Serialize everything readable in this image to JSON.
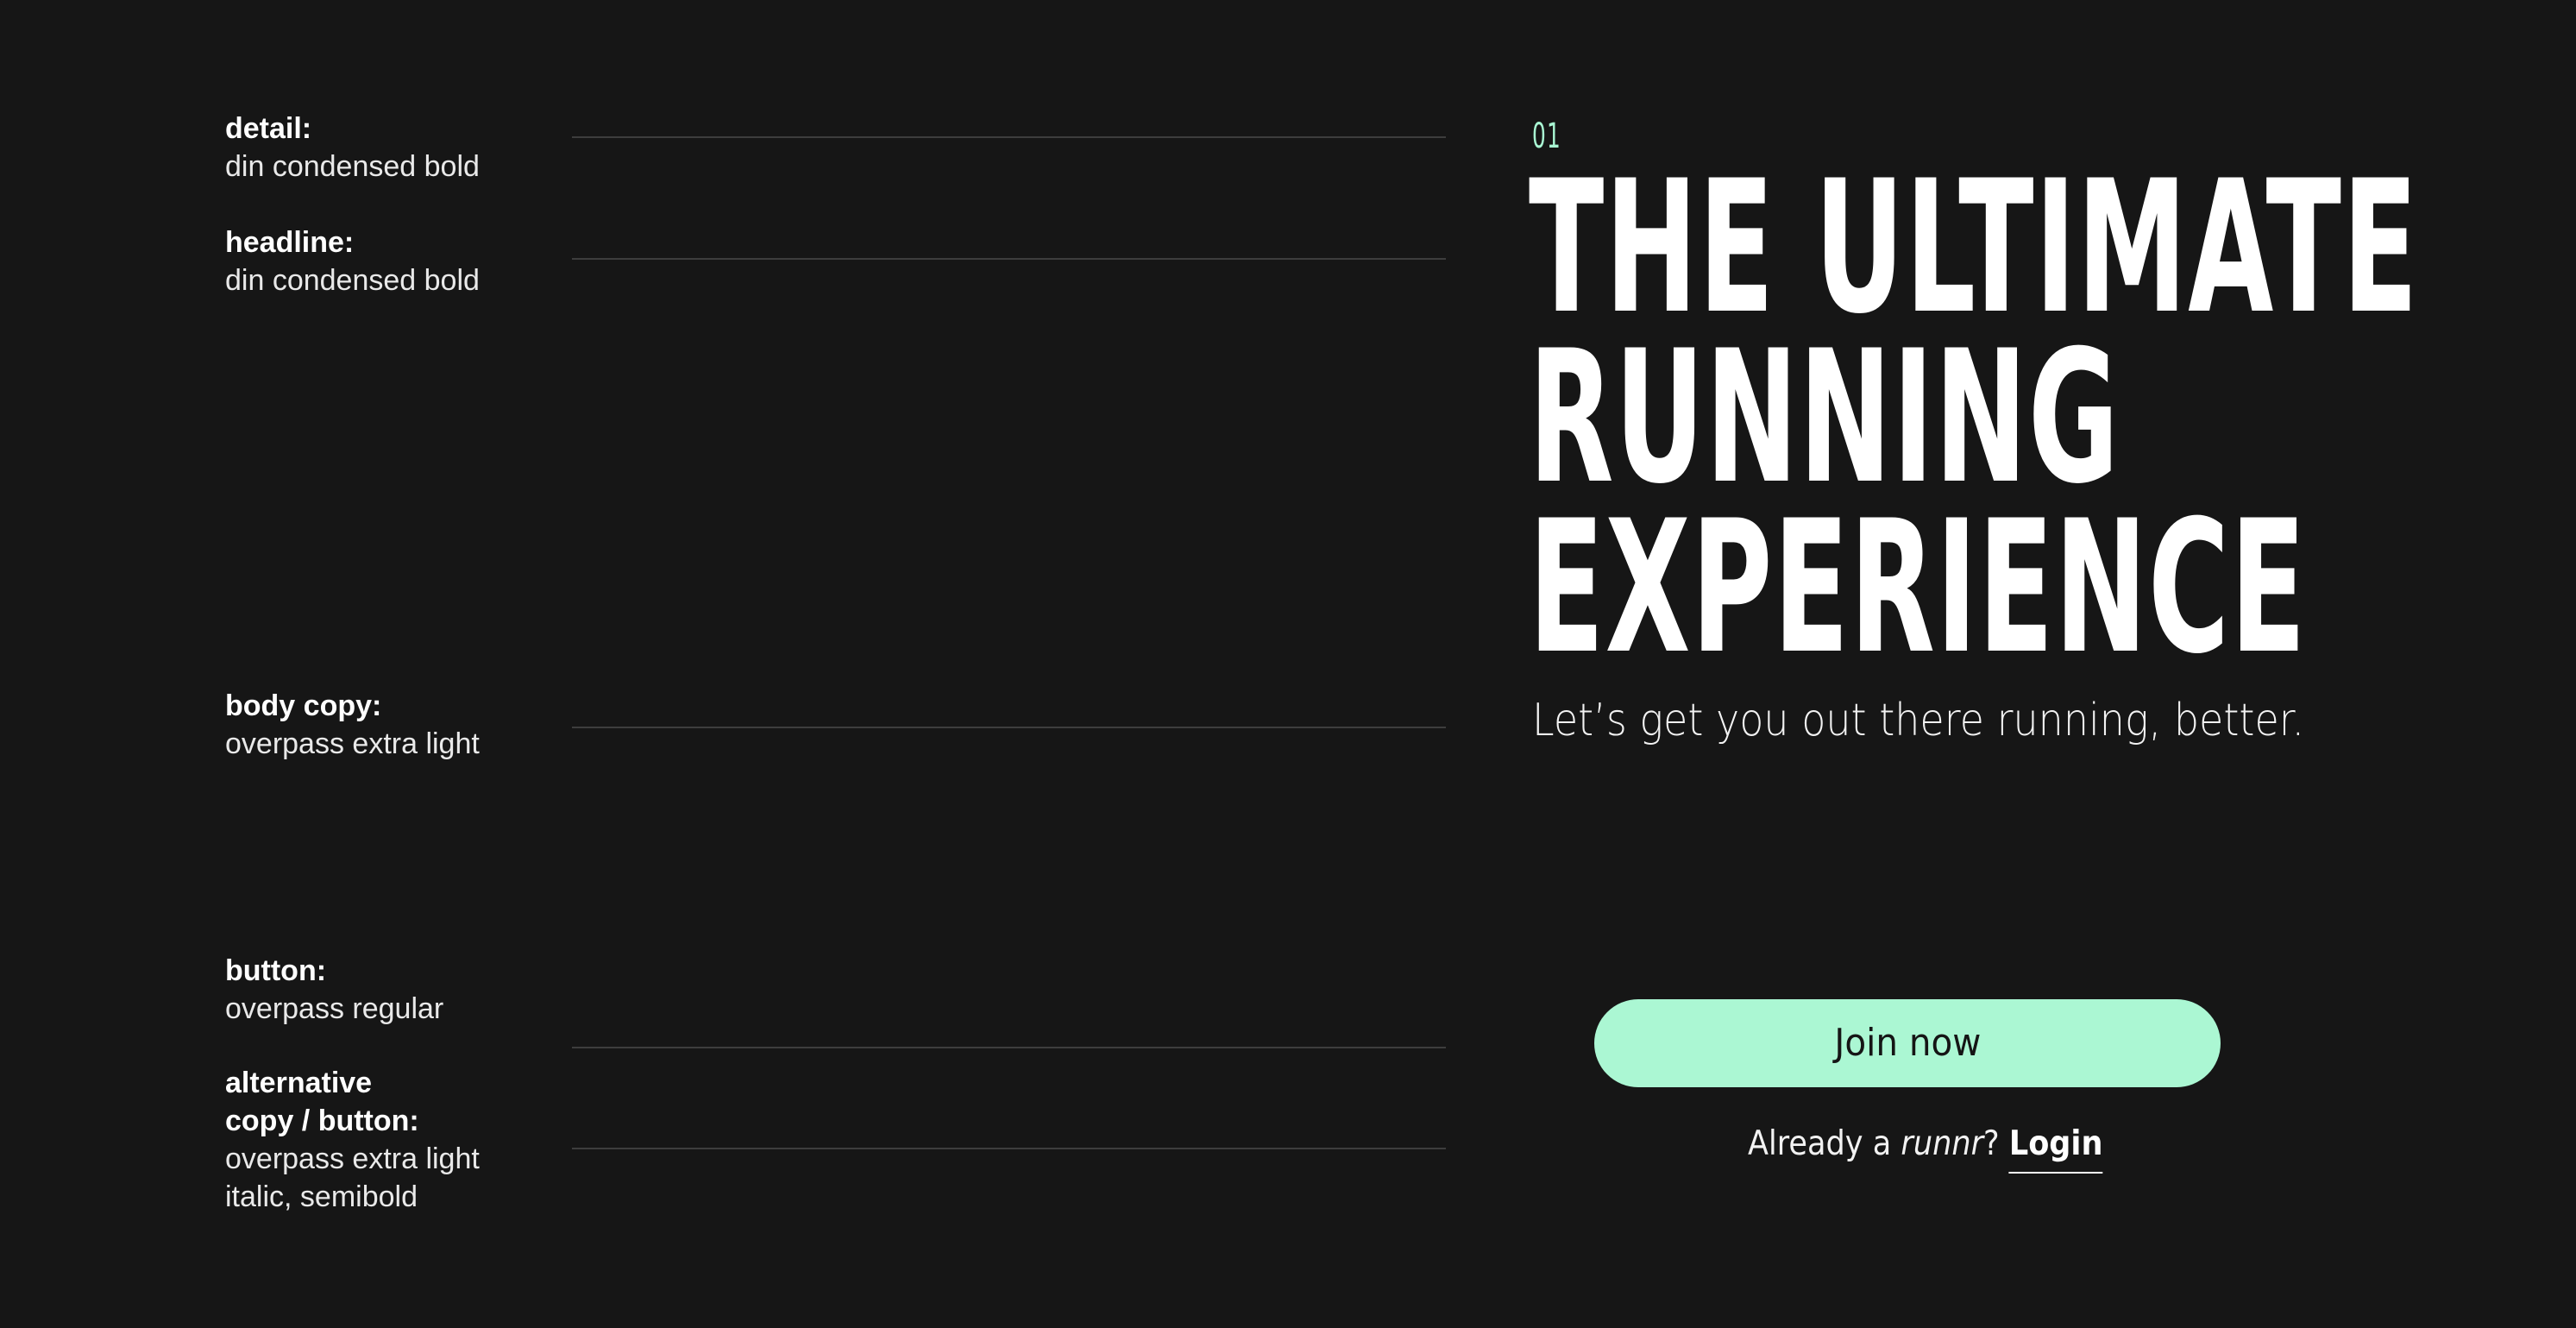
{
  "annotations": [
    {
      "label": "detail:",
      "value": "din condensed bold"
    },
    {
      "label": "headline:",
      "value": "din condensed bold"
    },
    {
      "label": "body copy:",
      "value": "overpass extra light"
    },
    {
      "label": "button:",
      "value": "overpass regular"
    },
    {
      "label_line1": "alternative",
      "label_line2": "copy / button:",
      "value_line1": "overpass extra light",
      "value_line2": "italic, semibold"
    }
  ],
  "preview": {
    "detail": "01",
    "headline": [
      "THE ULTIMATE",
      "RUNNING",
      "EXPERIENCE"
    ],
    "body": "Let’s get you out there running, better.",
    "button_label": "Join now",
    "alt_prefix": "Already a ",
    "alt_brand": "runnr",
    "alt_suffix": "? ",
    "login_label": "Login"
  },
  "colors": {
    "background": "#161616",
    "accent": "#abf7d3",
    "text": "#ffffff",
    "guide_line": "#3d3d3d"
  }
}
